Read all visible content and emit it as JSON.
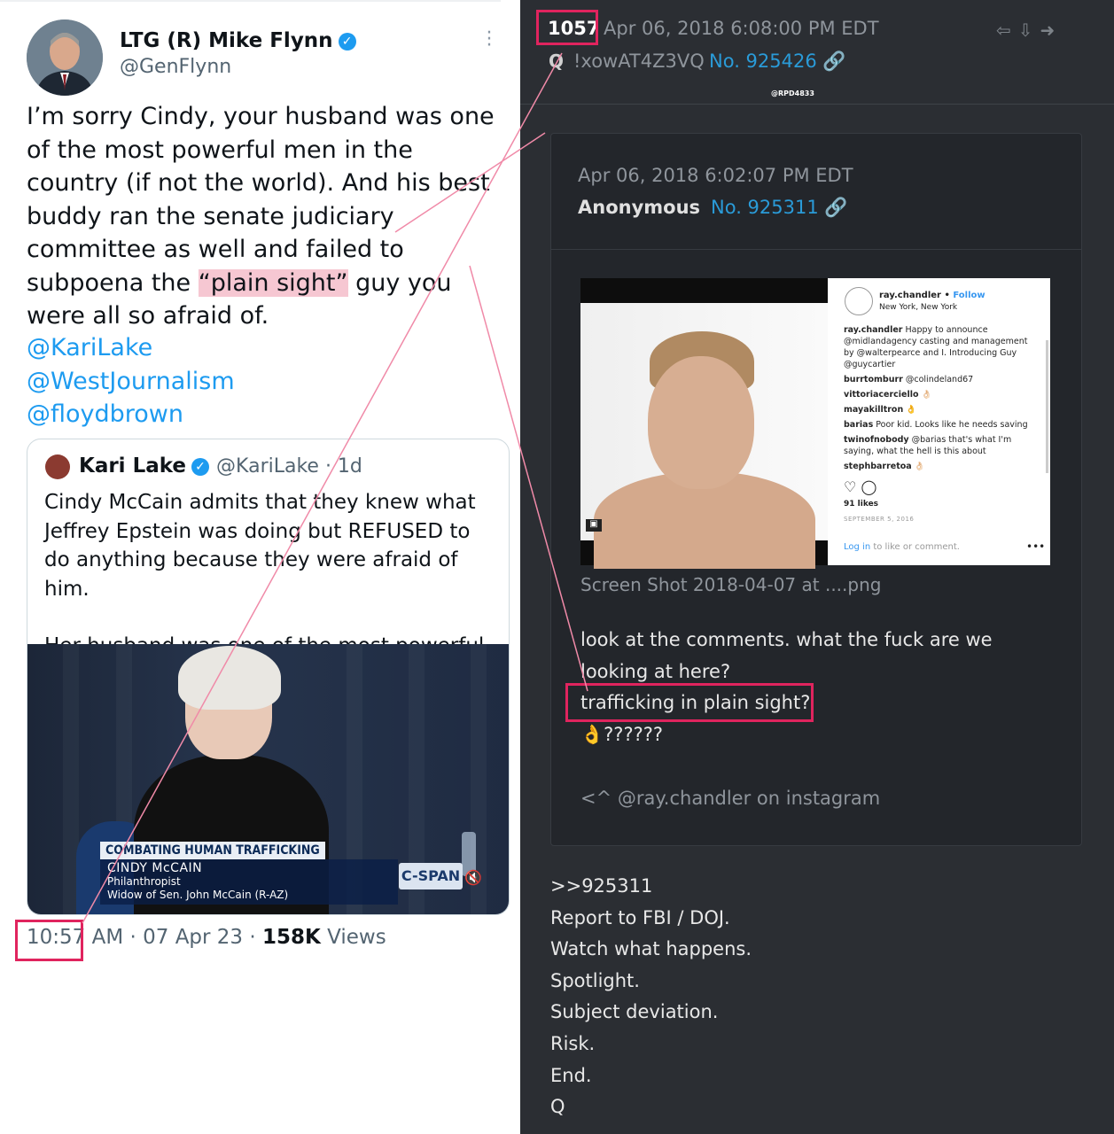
{
  "tweet": {
    "name": "LTG (R) Mike Flynn",
    "handle": "@GenFlynn",
    "text_before": "I’m sorry Cindy, your husband was one of the most powerful men in the country (if not the world). And his best buddy ran the senate judiciary committee as well and failed to subpoena the ",
    "highlight": "“plain sight”",
    "text_after": " guy you were all so afraid of.",
    "mentions": [
      "@KariLake",
      "@WestJournalism",
      "@floydbrown"
    ],
    "time": "10:57",
    "time_rest": " AM · 07 Apr 23 · ",
    "views_count": "158K",
    "views_label": " Views"
  },
  "quote": {
    "name": "Kari Lake",
    "handle_time": "@KariLake · 1d",
    "text1": "Cindy McCain admits that they knew what Jeffrey Epstein was doing but REFUSED to do anything because they were afraid of him.",
    "text2": "Her husband was one of the most powerful ...",
    "video": {
      "banner_title": "COMBATING HUMAN TRAFFICKING",
      "banner_name": "CINDY McCAIN",
      "banner_role1": "Philanthropist",
      "banner_role2": "Widow of Sen. John McCain (R-AZ)",
      "network": "C-SPAN"
    }
  },
  "qpost": {
    "number": "1057",
    "date": "Apr 06, 2018 6:08:00 PM EDT",
    "q": "Q",
    "tripcode": "!xowAT4Z3VQ",
    "post_no": "No. 925426",
    "watermark": "@RPD4833",
    "card": {
      "date": "Apr 06, 2018 6:02:07 PM EDT",
      "author": "Anonymous",
      "post_no": "No. 925311",
      "filename": "Screen Shot 2018-04-07 at ....png",
      "body": [
        "look at the comments. what the fuck are we looking at here?",
        "trafficking in plain sight?",
        "👌??????"
      ],
      "signature": "<^ @ray.chandler on instagram",
      "instagram": {
        "user": "ray.chandler",
        "follow": "Follow",
        "location": "New York, New York",
        "comments": [
          {
            "user": "ray.chandler",
            "text": "Happy to announce @midlandagency casting and management by @walterpearce and I. Introducing Guy @guycartier"
          },
          {
            "user": "burrtomburr",
            "text": "@colindeland67"
          },
          {
            "user": "vittoriacerciello",
            "text": "👌🏻"
          },
          {
            "user": "mayakilltron",
            "text": "👌"
          },
          {
            "user": "barias",
            "text": "Poor kid. Looks like he needs saving"
          },
          {
            "user": "twinofnobody",
            "text": "@barias that's what I'm saying, what the hell is this about"
          },
          {
            "user": "stephbarretoa",
            "text": "👌🏻"
          }
        ],
        "likes": "91 likes",
        "date": "SEPTEMBER 5, 2016",
        "login_link": "Log in",
        "login_rest": " to like or comment."
      }
    },
    "drop_lines": [
      ">>925311",
      "Report to FBI / DOJ.",
      "Watch what happens.",
      "Spotlight.",
      "Subject deviation.",
      "Risk.",
      "End.",
      "Q"
    ]
  },
  "colors": {
    "highlight": "#f6c7d2",
    "box": "#e0245e",
    "link": "#2a9bd8",
    "twitter_blue": "#1d9bf0"
  }
}
